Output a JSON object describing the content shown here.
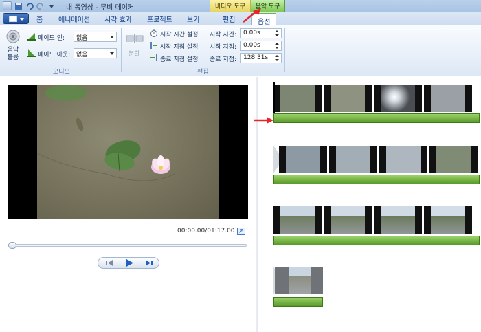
{
  "window": {
    "title": "내 동영상 - 무비 메이커",
    "context_tabs": {
      "video_tools": "비디오 도구",
      "music_tools": "음악 도구"
    }
  },
  "tabs": [
    {
      "label": "홈"
    },
    {
      "label": "애니메이션"
    },
    {
      "label": "시각 효과"
    },
    {
      "label": "프로젝트"
    },
    {
      "label": "보기"
    },
    {
      "label": "편집"
    },
    {
      "label": "옵션"
    }
  ],
  "ribbon": {
    "audio_group": {
      "label": "오디오",
      "volume_label": "음악\n볼륨",
      "fade_in_label": "페이드 인:",
      "fade_in_value": "없음",
      "fade_out_label": "페이드 아웃:",
      "fade_out_value": "없음"
    },
    "edit_group": {
      "label": "편집",
      "split_label": "분할",
      "set_start_time": "시작 시간 설정",
      "set_start_point": "시작 지점 설정",
      "set_end_point": "종료 지점 설정",
      "start_time_label": "시작 시간:",
      "start_time_value": "0.00s",
      "start_point_label": "시작 지점:",
      "start_point_value": "0.00s",
      "end_point_label": "종료 지점:",
      "end_point_value": "128.31s"
    }
  },
  "preview": {
    "time": "00:00.00/01:17.00",
    "progress": 0.0
  },
  "colors": {
    "music_tools": "#7cc44e",
    "video_tools": "#e5d35f",
    "audio_bar": "#5a9a2a",
    "annotation_arrow": "#e8262a"
  }
}
